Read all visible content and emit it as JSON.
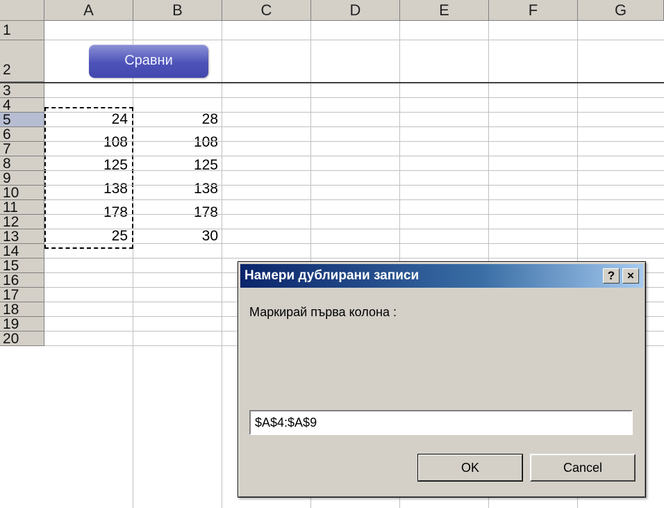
{
  "spreadsheet": {
    "columns": [
      "A",
      "B",
      "C",
      "D",
      "E",
      "F",
      "G"
    ],
    "rows": [
      "1",
      "2",
      "3",
      "4",
      "5",
      "6",
      "7",
      "8",
      "9",
      "10",
      "11",
      "12",
      "13",
      "14",
      "15",
      "16",
      "17",
      "18",
      "19",
      "20"
    ],
    "selected_row": "5",
    "column_a_values": [
      "24",
      "108",
      "125",
      "138",
      "178",
      "25"
    ],
    "column_b_values": [
      "28",
      "108",
      "125",
      "138",
      "178",
      "30"
    ]
  },
  "compare_button": {
    "label": "Сравни"
  },
  "dialog": {
    "title": "Намери дублирани записи",
    "help_label": "?",
    "close_label": "×",
    "prompt": "Маркирай първа колона :",
    "input_value": "$A$4:$A$9",
    "ok_label": "OK",
    "cancel_label": "Cancel"
  },
  "colors": {
    "title_bar_start": "#0a246a",
    "title_bar_end": "#a6caf0",
    "button_accent": "#4d53b8",
    "header_gray": "#d4d0c8"
  }
}
